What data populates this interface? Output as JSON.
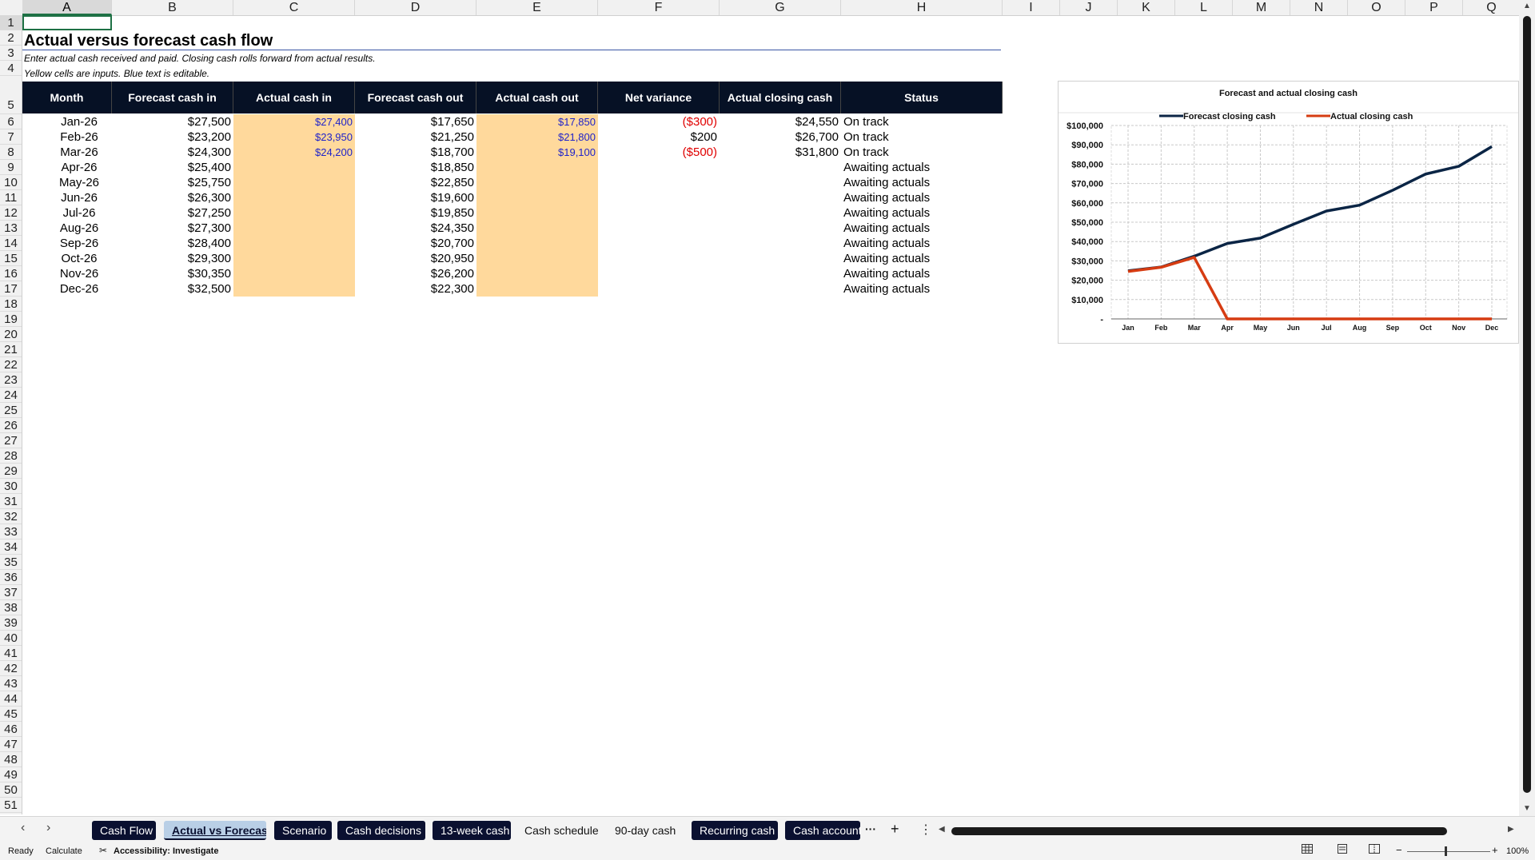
{
  "columns": [
    "A",
    "B",
    "C",
    "D",
    "E",
    "F",
    "G",
    "H",
    "I",
    "J",
    "K",
    "L",
    "M",
    "N",
    "O",
    "P",
    "Q"
  ],
  "rows": [
    "1",
    "2",
    "3",
    "4",
    "5",
    "6",
    "7",
    "8",
    "9",
    "10",
    "11",
    "12",
    "13",
    "14",
    "15",
    "16",
    "17",
    "18",
    "19",
    "20",
    "21",
    "22",
    "23",
    "24",
    "25",
    "26",
    "27",
    "28",
    "29",
    "30",
    "31",
    "32",
    "33",
    "34",
    "35",
    "36",
    "37",
    "38",
    "39",
    "40",
    "41",
    "42",
    "43",
    "44",
    "45",
    "46",
    "47",
    "48",
    "49",
    "50",
    "51"
  ],
  "sheet": {
    "title": "Actual versus forecast cash flow",
    "note1": "Enter actual cash received and paid. Closing cash rolls forward from actual results.",
    "note2": "Yellow cells are inputs. Blue text is editable.",
    "headers": [
      "Month",
      "Forecast cash in",
      "Actual cash in",
      "Forecast cash out",
      "Actual cash out",
      "Net variance",
      "Actual closing cash",
      "Status"
    ],
    "data": [
      {
        "month": "Jan-26",
        "fin": "$27,500",
        "ain": "$27,400",
        "fout": "$17,650",
        "aout": "$17,850",
        "var": "($300)",
        "close": "$24,550",
        "status": "On track"
      },
      {
        "month": "Feb-26",
        "fin": "$23,200",
        "ain": "$23,950",
        "fout": "$21,250",
        "aout": "$21,800",
        "var": "$200",
        "close": "$26,700",
        "status": "On track"
      },
      {
        "month": "Mar-26",
        "fin": "$24,300",
        "ain": "$24,200",
        "fout": "$18,700",
        "aout": "$19,100",
        "var": "($500)",
        "close": "$31,800",
        "status": "On track"
      },
      {
        "month": "Apr-26",
        "fin": "$25,400",
        "ain": "",
        "fout": "$18,850",
        "aout": "",
        "var": "",
        "close": "",
        "status": "Awaiting actuals"
      },
      {
        "month": "May-26",
        "fin": "$25,750",
        "ain": "",
        "fout": "$22,850",
        "aout": "",
        "var": "",
        "close": "",
        "status": "Awaiting actuals"
      },
      {
        "month": "Jun-26",
        "fin": "$26,300",
        "ain": "",
        "fout": "$19,600",
        "aout": "",
        "var": "",
        "close": "",
        "status": "Awaiting actuals"
      },
      {
        "month": "Jul-26",
        "fin": "$27,250",
        "ain": "",
        "fout": "$19,850",
        "aout": "",
        "var": "",
        "close": "",
        "status": "Awaiting actuals"
      },
      {
        "month": "Aug-26",
        "fin": "$27,300",
        "ain": "",
        "fout": "$24,350",
        "aout": "",
        "var": "",
        "close": "",
        "status": "Awaiting actuals"
      },
      {
        "month": "Sep-26",
        "fin": "$28,400",
        "ain": "",
        "fout": "$20,700",
        "aout": "",
        "var": "",
        "close": "",
        "status": "Awaiting actuals"
      },
      {
        "month": "Oct-26",
        "fin": "$29,300",
        "ain": "",
        "fout": "$20,950",
        "aout": "",
        "var": "",
        "close": "",
        "status": "Awaiting actuals"
      },
      {
        "month": "Nov-26",
        "fin": "$30,350",
        "ain": "",
        "fout": "$26,200",
        "aout": "",
        "var": "",
        "close": "",
        "status": "Awaiting actuals"
      },
      {
        "month": "Dec-26",
        "fin": "$32,500",
        "ain": "",
        "fout": "$22,300",
        "aout": "",
        "var": "",
        "close": "",
        "status": "Awaiting actuals"
      }
    ]
  },
  "chart_data": {
    "type": "line",
    "title": "Forecast and actual closing cash",
    "categories": [
      "Jan",
      "Feb",
      "Mar",
      "Apr",
      "May",
      "Jun",
      "Jul",
      "Aug",
      "Sep",
      "Oct",
      "Nov",
      "Dec"
    ],
    "series": [
      {
        "name": "Forecast closing cash",
        "color": "#0b2545",
        "values": [
          24850,
          26800,
          32400,
          39000,
          41800,
          48900,
          55800,
          58800,
          66500,
          74900,
          78900,
          89100
        ]
      },
      {
        "name": "Actual closing cash",
        "color": "#d63c12",
        "values": [
          24550,
          26700,
          31800,
          0,
          0,
          0,
          0,
          0,
          0,
          0,
          0,
          0
        ]
      }
    ],
    "ylim": [
      0,
      100000
    ],
    "yticks": [
      "-",
      "$10,000",
      "$20,000",
      "$30,000",
      "$40,000",
      "$50,000",
      "$60,000",
      "$70,000",
      "$80,000",
      "$90,000",
      "$100,000"
    ],
    "grid": true,
    "legend": "top"
  },
  "tabs": {
    "items": [
      {
        "label": "Cash Flow",
        "style": "dark"
      },
      {
        "label": "Actual vs Forecast",
        "style": "active"
      },
      {
        "label": "Scenario",
        "style": "dark"
      },
      {
        "label": "Cash decisions",
        "style": "dark"
      },
      {
        "label": "13-week cash",
        "style": "dark"
      },
      {
        "label": "Cash schedule",
        "style": "plain"
      },
      {
        "label": "90-day cash",
        "style": "plain"
      },
      {
        "label": "Recurring cash",
        "style": "dark"
      },
      {
        "label": "Cash account",
        "style": "dark"
      }
    ],
    "more": "···",
    "add": "+",
    "options": "⋮"
  },
  "status": {
    "ready": "Ready",
    "calculate": "Calculate",
    "accessibility": "Accessibility: Investigate",
    "zoom": "100%"
  }
}
